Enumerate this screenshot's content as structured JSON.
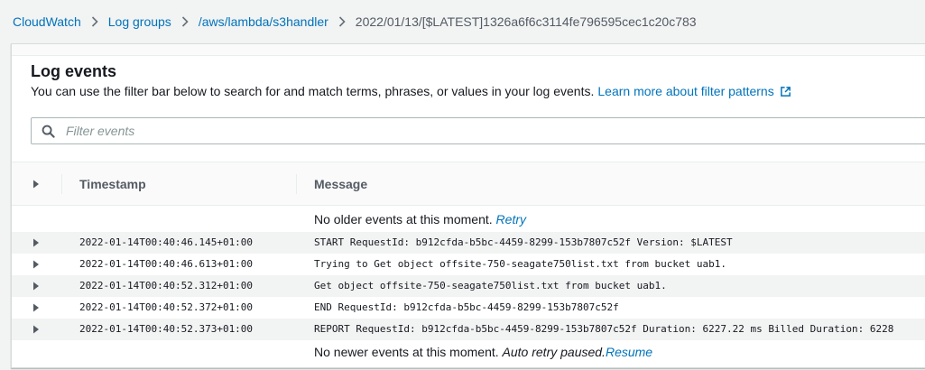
{
  "breadcrumb": [
    {
      "label": "CloudWatch"
    },
    {
      "label": "Log groups"
    },
    {
      "label": "/aws/lambda/s3handler"
    },
    {
      "label": "2022/01/13/[$LATEST]1326a6f6c3114fe796595cec1c20c783"
    }
  ],
  "log_events": {
    "title": "Log events",
    "description": "You can use the filter bar below to search for and match terms, phrases, or values in your log events.",
    "learn_more_link": "Learn more about filter patterns"
  },
  "filter": {
    "placeholder": "Filter events",
    "value": ""
  },
  "table": {
    "columns": [
      "Timestamp",
      "Message"
    ],
    "no_older": {
      "text": "No older events at this moment.",
      "link": "Retry"
    },
    "rows": [
      {
        "timestamp": "2022-01-14T00:40:46.145+01:00",
        "message": "START RequestId: b912cfda-b5bc-4459-8299-153b7807c52f Version: $LATEST"
      },
      {
        "timestamp": "2022-01-14T00:40:46.613+01:00",
        "message": "Trying to Get object offsite-750-seagate750list.txt from bucket uab1."
      },
      {
        "timestamp": "2022-01-14T00:40:52.312+01:00",
        "message": "Get object offsite-750-seagate750list.txt from bucket uab1."
      },
      {
        "timestamp": "2022-01-14T00:40:52.372+01:00",
        "message": "END RequestId: b912cfda-b5bc-4459-8299-153b7807c52f"
      },
      {
        "timestamp": "2022-01-14T00:40:52.373+01:00",
        "message": "REPORT RequestId: b912cfda-b5bc-4459-8299-153b7807c52f Duration: 6227.22 ms Billed Duration: 6228"
      }
    ],
    "no_newer": {
      "text": "No newer events at this moment.",
      "paused": "Auto retry paused.",
      "link": "Resume"
    }
  },
  "colors": {
    "link": "#0073bb",
    "text": "#16191f",
    "muted": "#545b64",
    "row_shade": "#f2f3f3"
  }
}
